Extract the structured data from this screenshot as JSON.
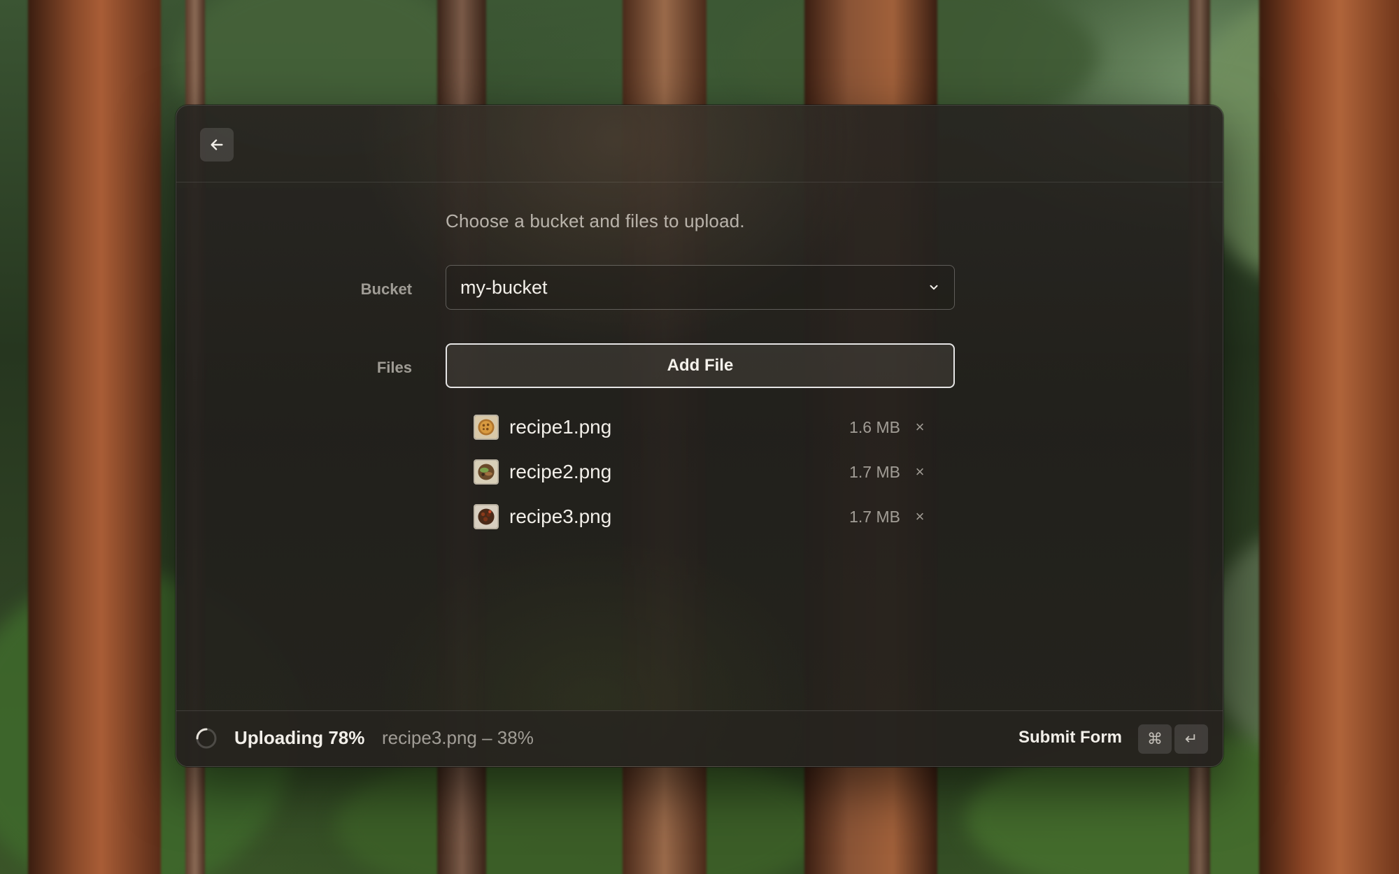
{
  "window": {
    "back_icon": "arrow-left-icon"
  },
  "form": {
    "subtitle": "Choose a bucket and files to upload.",
    "bucket": {
      "label": "Bucket",
      "value": "my-bucket",
      "icon": "chevron-down-icon"
    },
    "files": {
      "label": "Files",
      "add_button_label": "Add File",
      "items": [
        {
          "name": "recipe1.png",
          "size": "1.6 MB",
          "remove_glyph": "×"
        },
        {
          "name": "recipe2.png",
          "size": "1.7 MB",
          "remove_glyph": "×"
        },
        {
          "name": "recipe3.png",
          "size": "1.7 MB",
          "remove_glyph": "×"
        }
      ]
    }
  },
  "footer": {
    "status": "Uploading 78%",
    "detail": "recipe3.png – 38%",
    "submit_label": "Submit Form",
    "shortcut_keys": [
      "⌘",
      "↵"
    ]
  },
  "colors": {
    "window_bg": "#25221e",
    "text_primary": "#f2efe9",
    "text_secondary": "#a8a49c"
  }
}
